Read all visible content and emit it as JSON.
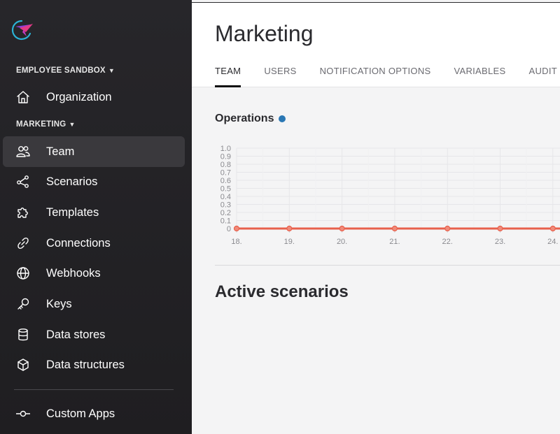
{
  "sidebar": {
    "sections": [
      {
        "label": "EMPLOYEE SANDBOX"
      },
      {
        "label": "MARKETING"
      }
    ],
    "items": [
      {
        "label": "Organization",
        "icon": "home-icon"
      },
      {
        "label": "Team",
        "icon": "users-icon",
        "active": true
      },
      {
        "label": "Scenarios",
        "icon": "share-nodes-icon"
      },
      {
        "label": "Templates",
        "icon": "puzzle-icon"
      },
      {
        "label": "Connections",
        "icon": "link-icon"
      },
      {
        "label": "Webhooks",
        "icon": "globe-icon"
      },
      {
        "label": "Keys",
        "icon": "key-icon"
      },
      {
        "label": "Data stores",
        "icon": "database-icon"
      },
      {
        "label": "Data structures",
        "icon": "cube-icon"
      },
      {
        "label": "Custom Apps",
        "icon": "node-line-icon"
      }
    ]
  },
  "main": {
    "title": "Marketing",
    "tabs": [
      {
        "label": "TEAM",
        "active": true
      },
      {
        "label": "USERS"
      },
      {
        "label": "NOTIFICATION OPTIONS"
      },
      {
        "label": "VARIABLES"
      },
      {
        "label": "AUDIT LOG"
      }
    ],
    "operations_title": "Operations",
    "active_scenarios_title": "Active scenarios"
  },
  "colors": {
    "sidebar_bg": "#27262a",
    "active_item_bg": "#3a393d",
    "series_line": "#e8604c",
    "operations_dot": "#2a77b4"
  },
  "chart_data": {
    "type": "line",
    "x": [
      "18.",
      "19.",
      "20.",
      "21.",
      "22.",
      "23.",
      "24."
    ],
    "series": [
      {
        "values": [
          0,
          0,
          0,
          0,
          0,
          0,
          0
        ]
      }
    ],
    "yticks": [
      "0",
      "0.1",
      "0.2",
      "0.3",
      "0.4",
      "0.5",
      "0.6",
      "0.7",
      "0.8",
      "0.9",
      "1.0"
    ],
    "ylim": [
      0,
      1
    ],
    "grid": true
  }
}
